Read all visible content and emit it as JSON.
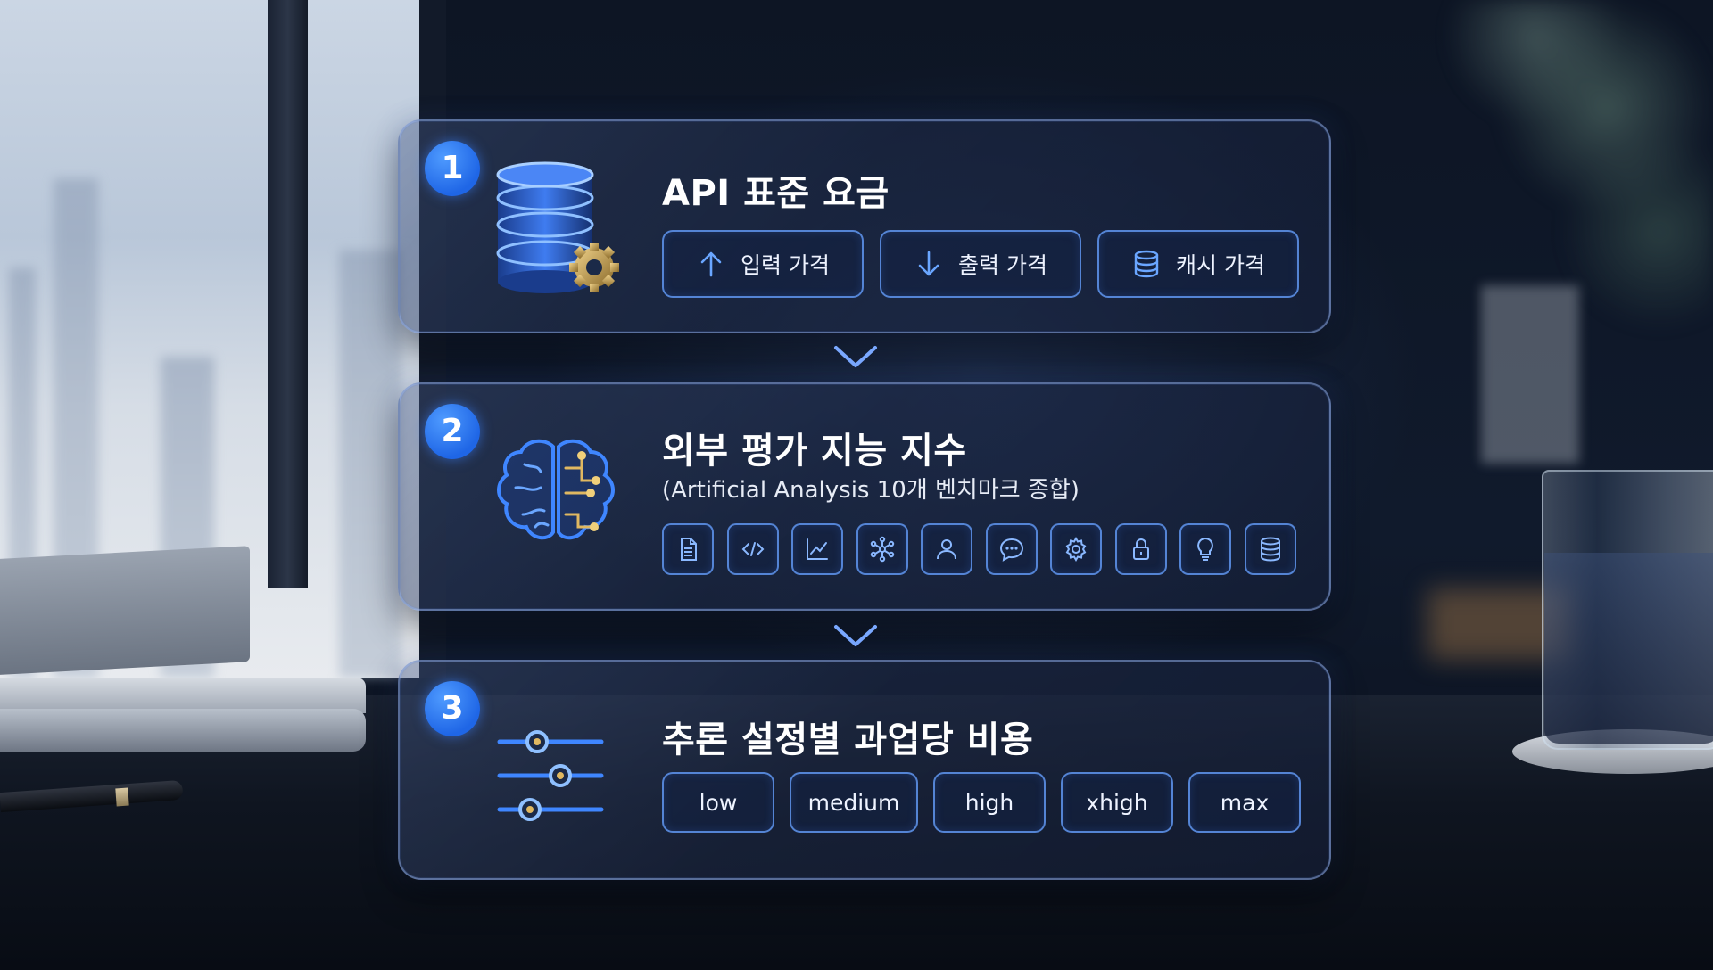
{
  "steps": [
    {
      "number": "1",
      "title": "API 표준 요금",
      "hero_icon": "database-gear-icon",
      "options": [
        {
          "icon": "arrow-up-icon",
          "label": "입력 가격"
        },
        {
          "icon": "arrow-down-icon",
          "label": "출력 가격"
        },
        {
          "icon": "database-icon",
          "label": "캐시 가격"
        }
      ]
    },
    {
      "number": "2",
      "title": "외부 평가 지능 지수",
      "subtitle": "(Artificial Analysis 10개 벤치마크 종합)",
      "hero_icon": "circuit-brain-icon",
      "benchmark_icons": [
        "document-icon",
        "code-icon",
        "chart-icon",
        "network-icon",
        "user-icon",
        "chat-icon",
        "gear-icon",
        "lock-icon",
        "lightbulb-icon",
        "database-icon"
      ]
    },
    {
      "number": "3",
      "title": "추론 설정별 과업당 비용",
      "hero_icon": "sliders-icon",
      "levels": [
        "low",
        "medium",
        "high",
        "xhigh",
        "max"
      ]
    }
  ],
  "connector_icon": "chevron-down-icon",
  "colors": {
    "accent": "#2f7bff",
    "border": "#6096f0",
    "text": "#ffffff"
  }
}
